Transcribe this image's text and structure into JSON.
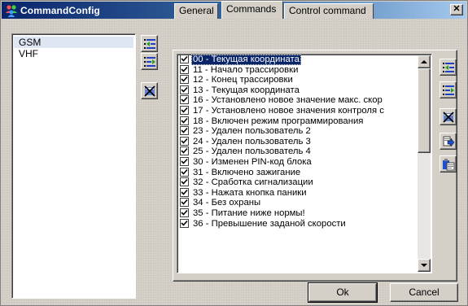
{
  "window": {
    "title": "CommandConfig",
    "close_glyph": "✕",
    "app_icon": "users-icon",
    "accent_color": "#0a246a"
  },
  "channels": {
    "items": [
      {
        "label": "GSM",
        "selected": true
      },
      {
        "label": "VHF",
        "selected": false
      }
    ]
  },
  "tabs": [
    {
      "label": "General",
      "active": false
    },
    {
      "label": "Commands",
      "active": true
    },
    {
      "label": "Control command",
      "active": false
    }
  ],
  "commands": {
    "items": [
      {
        "label": "00 - Текущая координата",
        "checked": true,
        "selected": true
      },
      {
        "label": "11 - Начало трассировки",
        "checked": true
      },
      {
        "label": "12 - Конец трассировки",
        "checked": true
      },
      {
        "label": "13 - Текущая координата",
        "checked": true
      },
      {
        "label": "16 - Установлено новое значение макс. скор",
        "checked": true
      },
      {
        "label": "17 - Установлено новое значения контроля с",
        "checked": true
      },
      {
        "label": "18 - Включен режим программирования",
        "checked": true
      },
      {
        "label": "23 - Удален пользователь 2",
        "checked": true
      },
      {
        "label": "24 - Удален пользователь 3",
        "checked": true
      },
      {
        "label": "25 - Удален пользователь 4",
        "checked": true
      },
      {
        "label": "30 - Изменен PIN-код блока",
        "checked": true
      },
      {
        "label": "31 - Включено зажигание",
        "checked": true
      },
      {
        "label": "32 - Сработка сигнализации",
        "checked": true
      },
      {
        "label": "33 - Нажата кнопка паники",
        "checked": true
      },
      {
        "label": "34 - Без охраны",
        "checked": true
      },
      {
        "label": "35 - Питание ниже нормы!",
        "checked": true
      },
      {
        "label": "36 - Превышение заданой скорости",
        "checked": true
      }
    ],
    "scroll_position": 0.0
  },
  "left_toolbar": [
    "move-up-icon",
    "move-down-icon",
    "delete-icon"
  ],
  "right_toolbar": [
    "move-up-icon",
    "move-down-icon",
    "delete-icon",
    "export-icon",
    "paste-icon"
  ],
  "buttons": {
    "ok": "Ok",
    "cancel": "Cancel"
  }
}
